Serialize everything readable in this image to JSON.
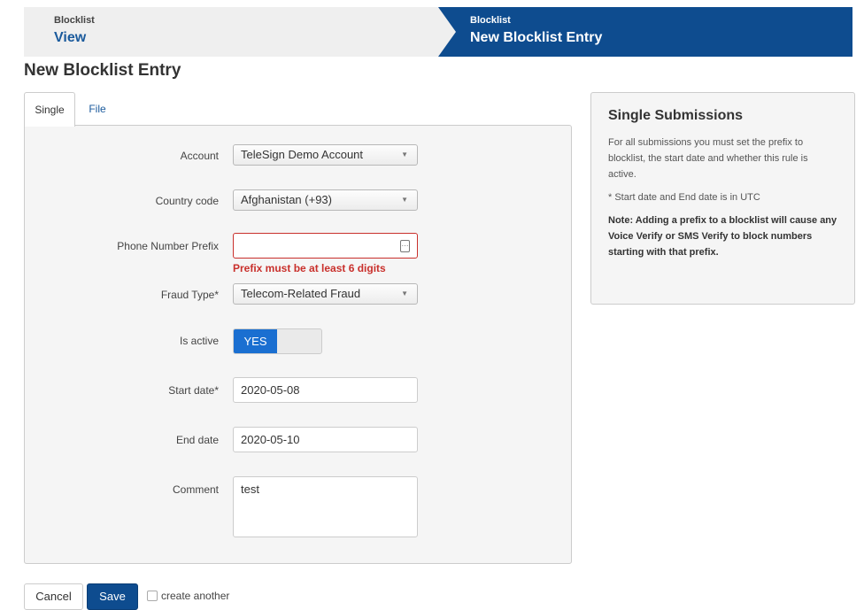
{
  "breadcrumb": {
    "items": [
      {
        "small": "Blocklist",
        "big": "View"
      },
      {
        "small": "Blocklist",
        "big": "New Blocklist Entry"
      }
    ]
  },
  "page": {
    "title": "New Blocklist Entry"
  },
  "tabs": [
    {
      "label": "Single",
      "active": true
    },
    {
      "label": "File",
      "active": false
    }
  ],
  "form": {
    "account": {
      "label": "Account",
      "value": "TeleSign Demo Account"
    },
    "country": {
      "label": "Country code",
      "value": "Afghanistan (+93)"
    },
    "prefix": {
      "label": "Phone Number Prefix",
      "value": "",
      "error": "Prefix must be at least 6 digits"
    },
    "fraud_type": {
      "label": "Fraud Type*",
      "value": "Telecom-Related Fraud"
    },
    "is_active": {
      "label": "Is active",
      "value": "YES"
    },
    "start_date": {
      "label": "Start date*",
      "value": "2020-05-08"
    },
    "end_date": {
      "label": "End date",
      "value": "2020-05-10"
    },
    "comment": {
      "label": "Comment",
      "value": "test"
    }
  },
  "side": {
    "title": "Single Submissions",
    "p1": "For all submissions you must set the prefix to blocklist, the start date and whether this rule is active.",
    "p2": "* Start date and End date is in UTC",
    "note": "Note: Adding a prefix to a blocklist will cause any Voice Verify or SMS Verify to block numbers starting with that prefix."
  },
  "footer": {
    "cancel_label": "Cancel",
    "save_label": "Save",
    "create_another_label": "create another"
  },
  "colors": {
    "primary": "#0e4c8f",
    "toggle_on": "#1a6fd1",
    "error": "#c9302c"
  }
}
